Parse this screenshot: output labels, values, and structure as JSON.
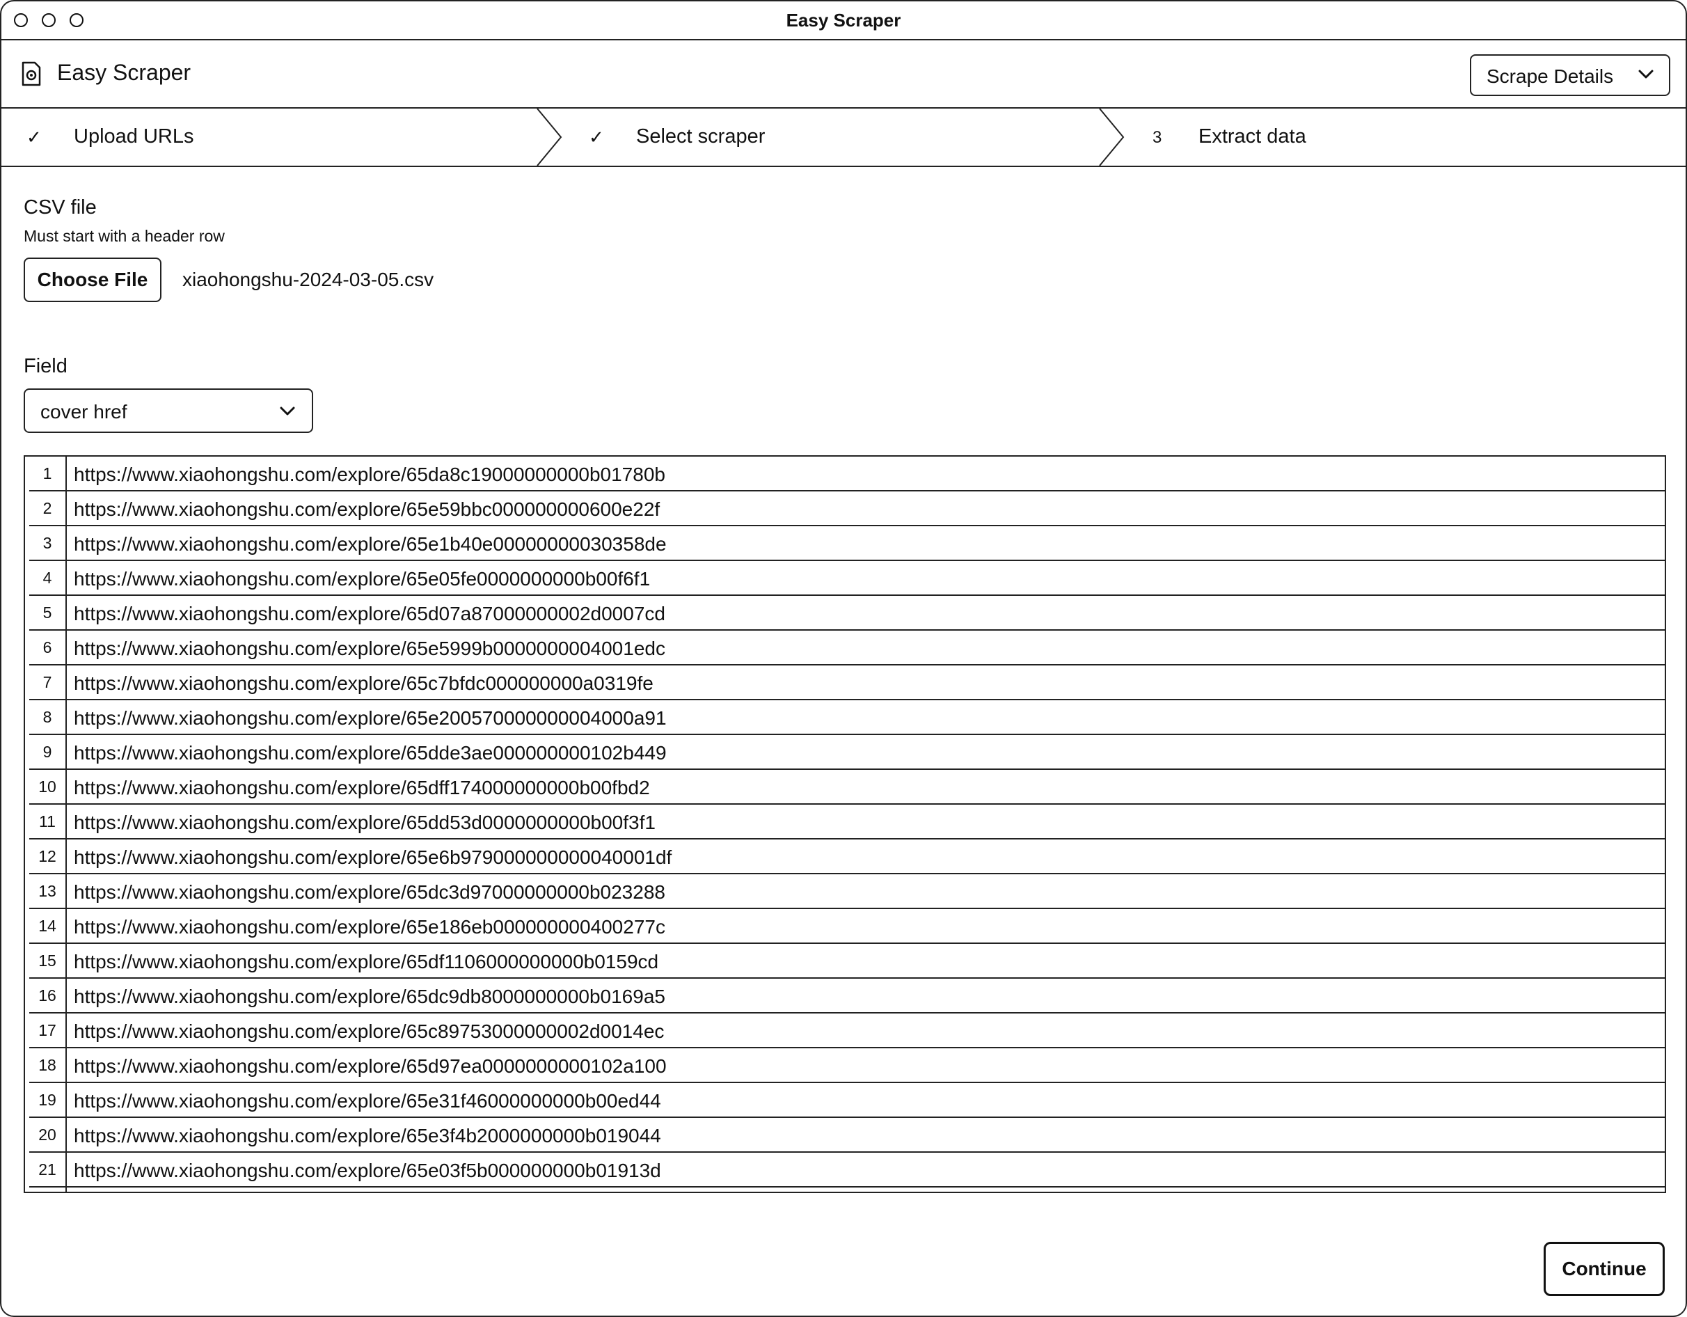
{
  "window": {
    "title": "Easy Scraper"
  },
  "header": {
    "app_name": "Easy Scraper",
    "app_icon": "document-gear-icon",
    "details_dropdown": "Scrape Details"
  },
  "steps": [
    {
      "mark": "✓",
      "label": "Upload URLs"
    },
    {
      "mark": "✓",
      "label": "Select scraper"
    },
    {
      "mark": "3",
      "label": "Extract data"
    }
  ],
  "csv": {
    "label": "CSV file",
    "hint": "Must start with a header row",
    "choose_button": "Choose File",
    "file_name": "xiaohongshu-2024-03-05.csv"
  },
  "field": {
    "label": "Field",
    "selected": "cover href"
  },
  "table": {
    "rows": [
      {
        "num": "1",
        "url": "https://www.xiaohongshu.com/explore/65da8c19000000000b01780b"
      },
      {
        "num": "2",
        "url": "https://www.xiaohongshu.com/explore/65e59bbc000000000600e22f"
      },
      {
        "num": "3",
        "url": "https://www.xiaohongshu.com/explore/65e1b40e00000000030358de"
      },
      {
        "num": "4",
        "url": "https://www.xiaohongshu.com/explore/65e05fe0000000000b00f6f1"
      },
      {
        "num": "5",
        "url": "https://www.xiaohongshu.com/explore/65d07a87000000002d0007cd"
      },
      {
        "num": "6",
        "url": "https://www.xiaohongshu.com/explore/65e5999b0000000004001edc"
      },
      {
        "num": "7",
        "url": "https://www.xiaohongshu.com/explore/65c7bfdc000000000a0319fe"
      },
      {
        "num": "8",
        "url": "https://www.xiaohongshu.com/explore/65e200570000000004000a91"
      },
      {
        "num": "9",
        "url": "https://www.xiaohongshu.com/explore/65dde3ae000000000102b449"
      },
      {
        "num": "10",
        "url": "https://www.xiaohongshu.com/explore/65dff174000000000b00fbd2"
      },
      {
        "num": "11",
        "url": "https://www.xiaohongshu.com/explore/65dd53d0000000000b00f3f1"
      },
      {
        "num": "12",
        "url": "https://www.xiaohongshu.com/explore/65e6b979000000000040001df"
      },
      {
        "num": "13",
        "url": "https://www.xiaohongshu.com/explore/65dc3d97000000000b023288"
      },
      {
        "num": "14",
        "url": "https://www.xiaohongshu.com/explore/65e186eb000000000400277c"
      },
      {
        "num": "15",
        "url": "https://www.xiaohongshu.com/explore/65df1106000000000b0159cd"
      },
      {
        "num": "16",
        "url": "https://www.xiaohongshu.com/explore/65dc9db8000000000b0169a5"
      },
      {
        "num": "17",
        "url": "https://www.xiaohongshu.com/explore/65c89753000000002d0014ec"
      },
      {
        "num": "18",
        "url": "https://www.xiaohongshu.com/explore/65d97ea0000000000102a100"
      },
      {
        "num": "19",
        "url": "https://www.xiaohongshu.com/explore/65e31f46000000000b00ed44"
      },
      {
        "num": "20",
        "url": "https://www.xiaohongshu.com/explore/65e3f4b2000000000b019044"
      },
      {
        "num": "21",
        "url": "https://www.xiaohongshu.com/explore/65e03f5b000000000b01913d"
      }
    ]
  },
  "footer": {
    "continue_button": "Continue"
  }
}
